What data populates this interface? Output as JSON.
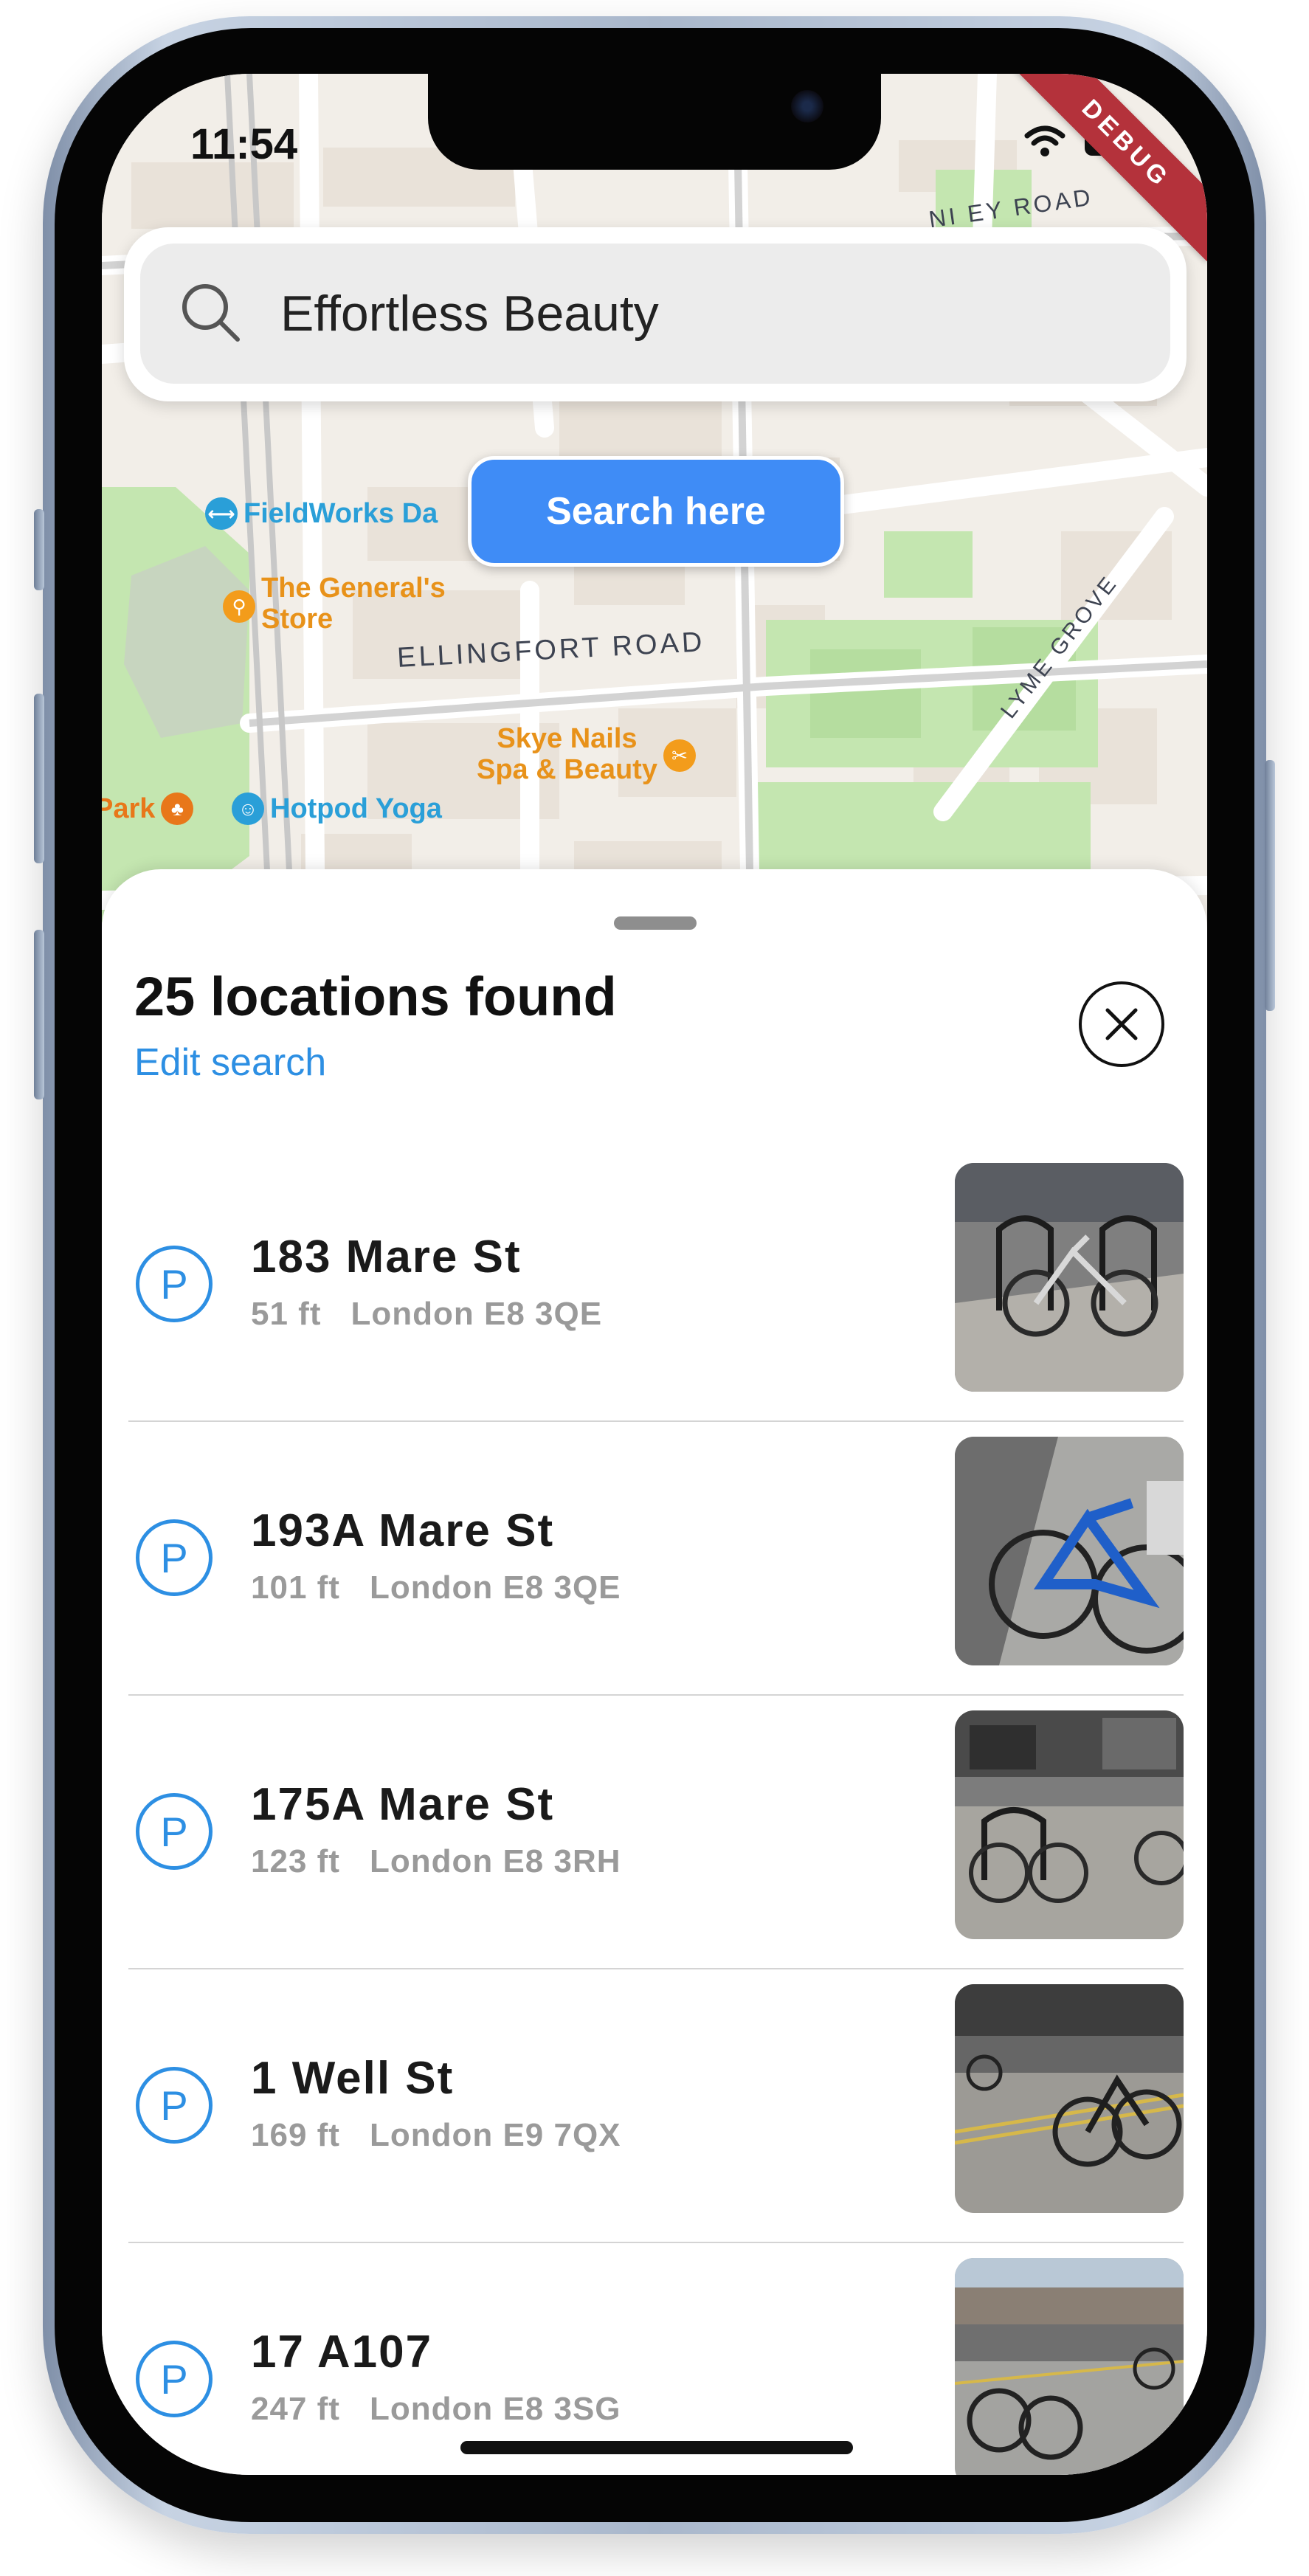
{
  "status_bar": {
    "time": "11:54",
    "debug_label": "DEBUG"
  },
  "search": {
    "value": "Effortless Beauty",
    "search_here_label": "Search here"
  },
  "map": {
    "roads": [
      "ELLINGFORT ROAD",
      "LYME GROVE",
      "NI EY ROAD"
    ],
    "pois": [
      {
        "label": "FieldWorks Da",
        "color": "#2a9fd8",
        "icon": "gym-icon"
      },
      {
        "label": "The General's",
        "label2": "Store",
        "color": "#f39c1b",
        "icon": "shopping-icon"
      },
      {
        "label": "Skye Nails",
        "label2": "Spa & Beauty",
        "color": "#f39c1b",
        "icon": "beauty-icon"
      },
      {
        "label": "Park",
        "color": "#e8771a",
        "icon": "park-icon"
      },
      {
        "label": "Hotpod Yoga",
        "color": "#2a9fd8",
        "icon": "yoga-icon"
      }
    ]
  },
  "sheet": {
    "title": "25 locations found",
    "edit_label": "Edit search",
    "close_icon": "close-icon"
  },
  "locations": [
    {
      "name": "183 Mare St",
      "distance": "51 ft",
      "area": "London E8 3QE",
      "icon": "P"
    },
    {
      "name": "193A Mare St",
      "distance": "101 ft",
      "area": "London E8 3QE",
      "icon": "P"
    },
    {
      "name": "175A Mare St",
      "distance": "123 ft",
      "area": "London E8 3RH",
      "icon": "P"
    },
    {
      "name": "1 Well St",
      "distance": "169 ft",
      "area": "London E9 7QX",
      "icon": "P"
    },
    {
      "name": "17 A107",
      "distance": "247 ft",
      "area": "London E8 3SG",
      "icon": "P"
    }
  ],
  "colors": {
    "accent": "#2d8fe3",
    "button": "#3f8cf6",
    "debug": "#b4323b"
  }
}
